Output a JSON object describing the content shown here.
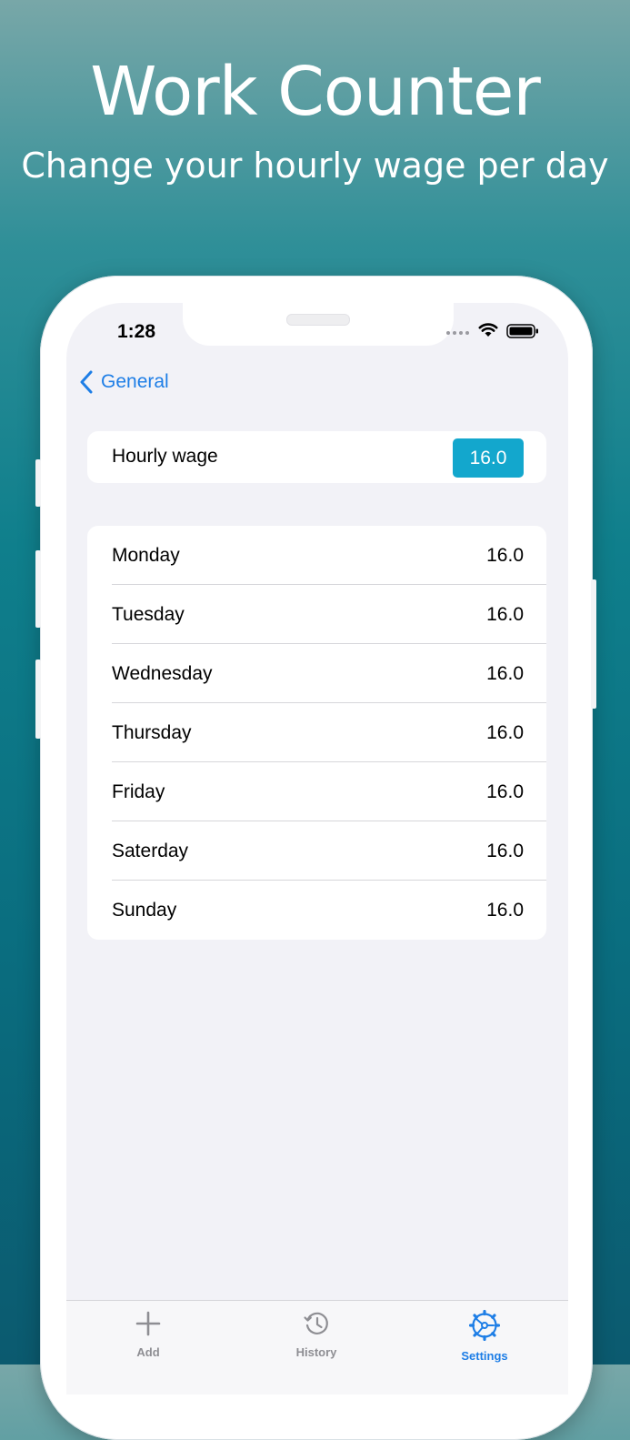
{
  "promo": {
    "title": "Work Counter",
    "subtitle": "Change your hourly wage per day"
  },
  "status_bar": {
    "time": "1:28"
  },
  "nav": {
    "back_label": "General"
  },
  "wage": {
    "label": "Hourly wage",
    "value": "16.0"
  },
  "days": [
    {
      "label": "Monday",
      "value": "16.0"
    },
    {
      "label": "Tuesday",
      "value": "16.0"
    },
    {
      "label": "Wednesday",
      "value": "16.0"
    },
    {
      "label": "Thursday",
      "value": "16.0"
    },
    {
      "label": "Friday",
      "value": "16.0"
    },
    {
      "label": "Saterday",
      "value": "16.0"
    },
    {
      "label": "Sunday",
      "value": "16.0"
    }
  ],
  "tabs": {
    "add": "Add",
    "history": "History",
    "settings": "Settings"
  },
  "colors": {
    "accent": "#1e7ee6",
    "wage_field": "#13a7cd"
  },
  "icons": {
    "back": "chevron-left-icon",
    "add": "plus-icon",
    "history": "history-clock-icon",
    "settings": "gear-icon"
  }
}
